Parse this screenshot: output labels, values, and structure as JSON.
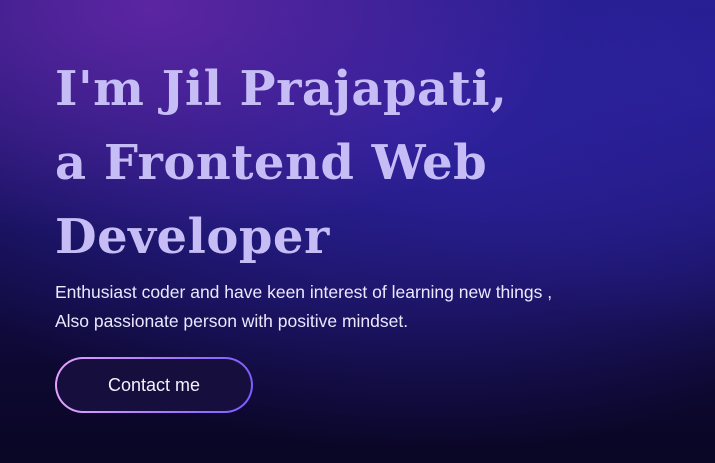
{
  "hero": {
    "headline_lines": [
      "I'm Jil Prajapati,",
      "a Frontend Web",
      "Developer"
    ],
    "tagline_lines": [
      "Enthusiast coder and have keen interest of learning new things ,",
      "Also passionate person with positive mindset."
    ],
    "cta_label": "Contact me"
  },
  "colors": {
    "headline": "#c7bdf6",
    "tagline": "#ece8ff",
    "cta_border_start": "#e4a3ff",
    "cta_border_end": "#7d5cff",
    "background_dark": "#0e0a2a",
    "background_accent": "#2e22a0"
  }
}
